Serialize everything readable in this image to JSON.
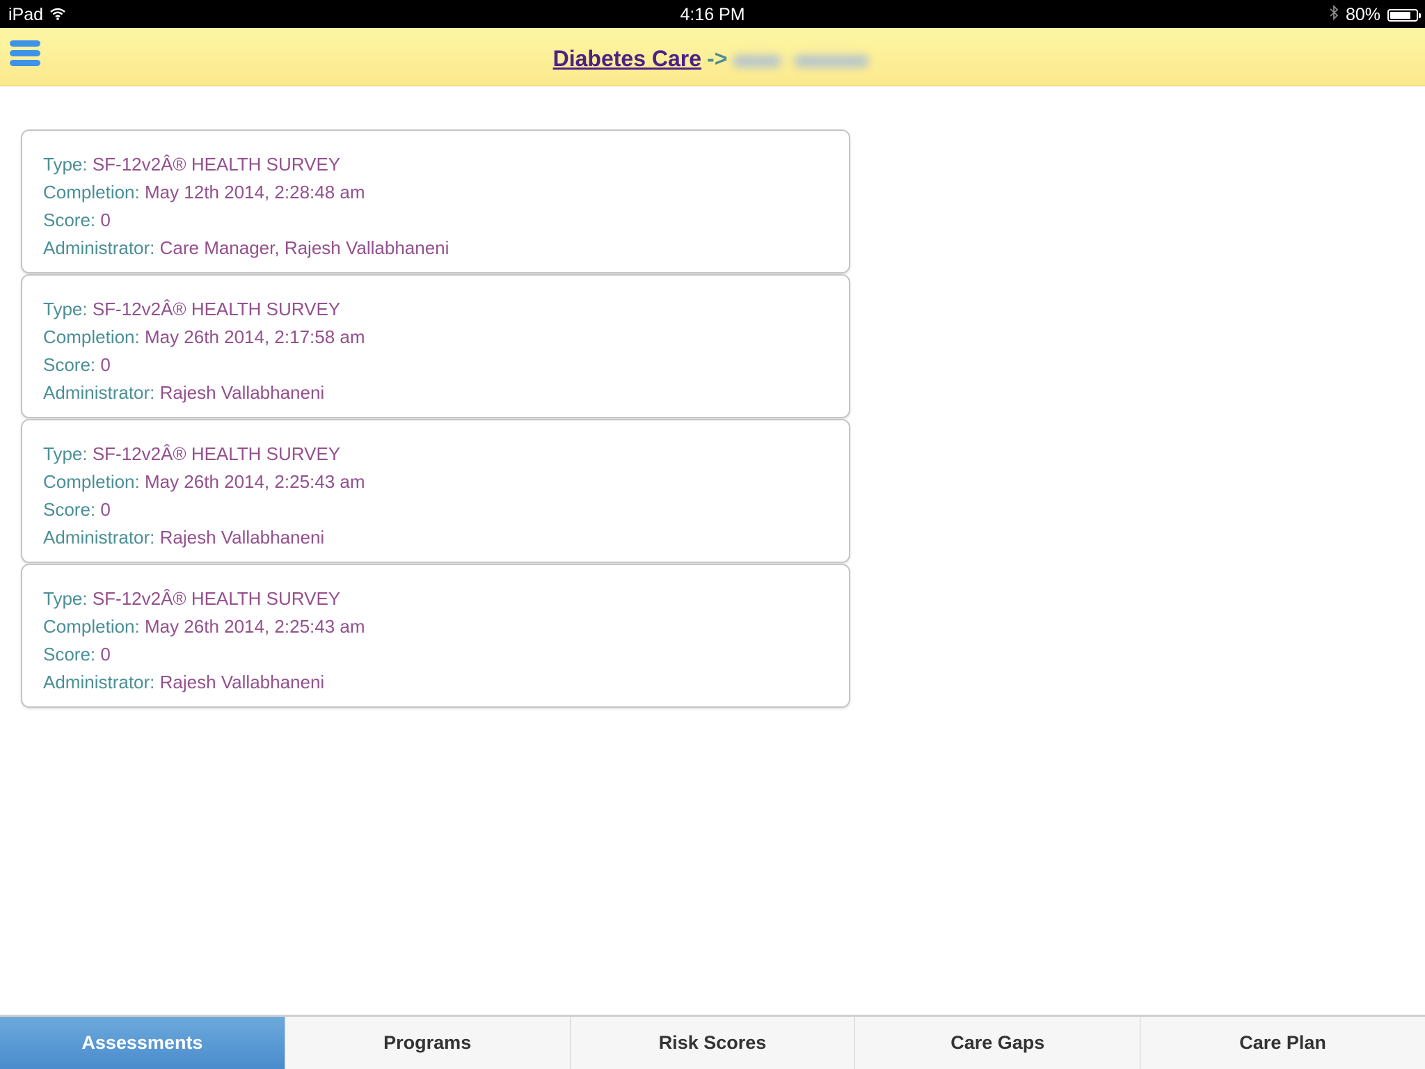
{
  "status_bar": {
    "device": "iPad",
    "time": "4:16 PM",
    "battery": "80%",
    "battery_level": 0.8
  },
  "header": {
    "program_link": "Diabetes Care",
    "arrow": "->",
    "patient_name": ""
  },
  "assessments": [
    {
      "type_label": "Type: ",
      "type": "SF-12v2Â® HEALTH SURVEY",
      "completion_label": "Completion: ",
      "completion": "May 12th 2014, 2:28:48 am",
      "score_label": "Score: ",
      "score": "0",
      "administrator_label": "Administrator: ",
      "administrator": "Care Manager, Rajesh Vallabhaneni"
    },
    {
      "type_label": "Type: ",
      "type": "SF-12v2Â® HEALTH SURVEY",
      "completion_label": "Completion: ",
      "completion": "May 26th 2014, 2:17:58 am",
      "score_label": "Score: ",
      "score": "0",
      "administrator_label": "Administrator: ",
      "administrator": "Rajesh Vallabhaneni"
    },
    {
      "type_label": "Type: ",
      "type": "SF-12v2Â® HEALTH SURVEY",
      "completion_label": "Completion: ",
      "completion": "May 26th 2014, 2:25:43 am",
      "score_label": "Score: ",
      "score": "0",
      "administrator_label": "Administrator: ",
      "administrator": "Rajesh Vallabhaneni"
    },
    {
      "type_label": "Type: ",
      "type": "SF-12v2Â® HEALTH SURVEY",
      "completion_label": "Completion: ",
      "completion": "May 26th 2014, 2:25:43 am",
      "score_label": "Score: ",
      "score": "0",
      "administrator_label": "Administrator: ",
      "administrator": "Rajesh Vallabhaneni"
    }
  ],
  "tabs": [
    {
      "label": "Assessments",
      "active": true
    },
    {
      "label": "Programs",
      "active": false
    },
    {
      "label": "Risk Scores",
      "active": false
    },
    {
      "label": "Care Gaps",
      "active": false
    },
    {
      "label": "Care Plan",
      "active": false
    }
  ],
  "colors": {
    "header_bg": "#fdf0a0",
    "link": "#4b2187",
    "label": "#4a8f96",
    "value": "#94508e",
    "menu_icon": "#3e92e8",
    "active_tab": "#5b9ad4"
  },
  "icons": {
    "menu": "hamburger-menu-icon",
    "wifi": "wifi-icon",
    "bluetooth": "bluetooth-icon",
    "battery": "battery-icon"
  }
}
